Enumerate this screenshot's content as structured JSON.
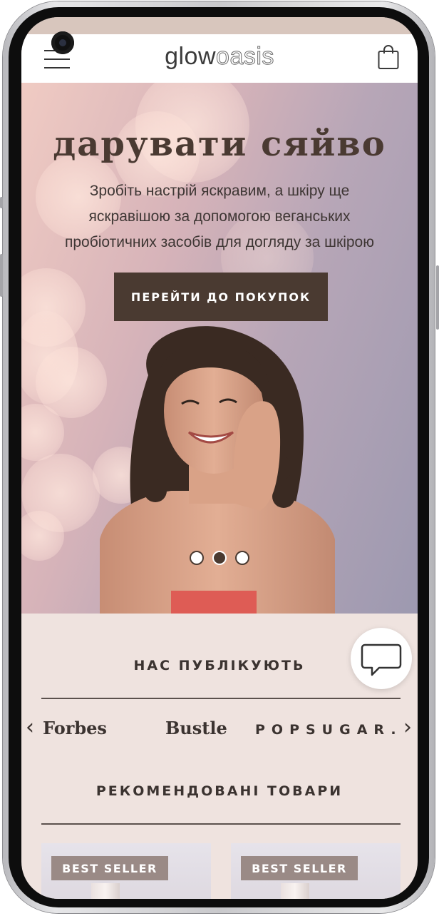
{
  "header": {
    "logo_bold": "glow",
    "logo_light": "oasis"
  },
  "hero": {
    "title": "дарувати сяйво",
    "subtitle_line1": "Зробіть настрій яскравим, а шкіру ще",
    "subtitle_line2": "яскравішою за допомогою веганських",
    "subtitle_line3": "пробіотичних засобів для догляду за шкірою",
    "cta": "ПЕРЕЙТИ ДО ПОКУПОК",
    "carousel_total": 3,
    "carousel_active": 2
  },
  "press": {
    "title": "НАС ПУБЛІКУЮТЬ",
    "logos": [
      "Forbes",
      "Bustle",
      "POPSUGAR."
    ]
  },
  "featured": {
    "title": "РЕКОМЕНДОВАНІ ТОВАРИ",
    "products": [
      {
        "badge": "BEST SELLER"
      },
      {
        "badge": "BEST SELLER"
      }
    ]
  },
  "colors": {
    "brand_dark": "#4a3a31",
    "page_bg": "#efe3df",
    "badge": "#9a8a86"
  },
  "icons": {
    "menu": "hamburger-menu-icon",
    "cart": "shopping-bag-icon",
    "chat": "chat-bubble-icon",
    "prev": "chevron-left-icon",
    "next": "chevron-right-icon"
  }
}
